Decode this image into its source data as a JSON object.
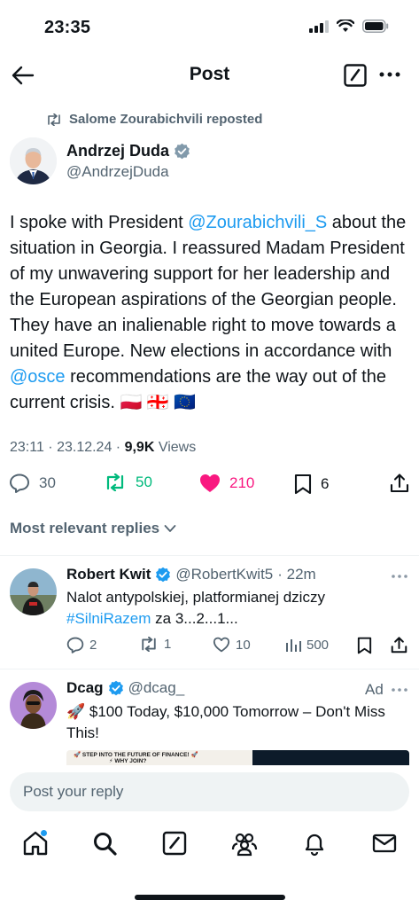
{
  "status_bar": {
    "time": "23:35"
  },
  "header": {
    "title": "Post"
  },
  "repost_banner": {
    "text": "Salome Zourabichvili reposted"
  },
  "post": {
    "author_name": "Andrzej Duda",
    "author_handle": "@AndrzejDuda",
    "text_parts": {
      "p1": "I spoke with President ",
      "mention1": "@Zourabichvili_S",
      "p2": " about the situation in Georgia. I reassured Madam President of my unwavering support for her leadership and the European aspirations of the Georgian people. They have an  inalienable right to move towards a united Europe. New elections in accordance with ",
      "mention2": "@osce",
      "p3": " recommendations are the way out of the current crisis. ",
      "flags": "🇵🇱 🇬🇪 🇪🇺"
    },
    "timestamp": "23:11 · 23.12.24 · ",
    "views_count": "9,9K",
    "views_label": " Views",
    "replies": "30",
    "reposts": "50",
    "likes": "210",
    "bookmarks": "6"
  },
  "sort": {
    "label": "Most relevant replies"
  },
  "replies": [
    {
      "name": "Robert Kwit",
      "handle": "@RobertKwit5",
      "time": "· 22m",
      "text_main": "Nalot antypolskiej, platformianej dziczy",
      "hashtag": "#SilniRazem",
      "text_end": " za 3...2...1...",
      "replies": "2",
      "reposts": "1",
      "likes": "10",
      "views": "500"
    }
  ],
  "ad": {
    "name": "Dcag",
    "handle": "@dcag_",
    "ad_label": "Ad",
    "text": "🚀 $100 Today, $10,000 Tomorrow – Don't Miss This!",
    "banner_text": "🚀 STEP INTO THE FUTURE OF FINANCE! 🚀",
    "banner_sub": "⚡ WHY JOIN?"
  },
  "composer": {
    "placeholder": "Post your reply"
  },
  "colors": {
    "accent": "#1d9bf0",
    "like": "#f91880",
    "repost": "#00ba7c",
    "text": "#0f1419",
    "muted": "#536471"
  }
}
